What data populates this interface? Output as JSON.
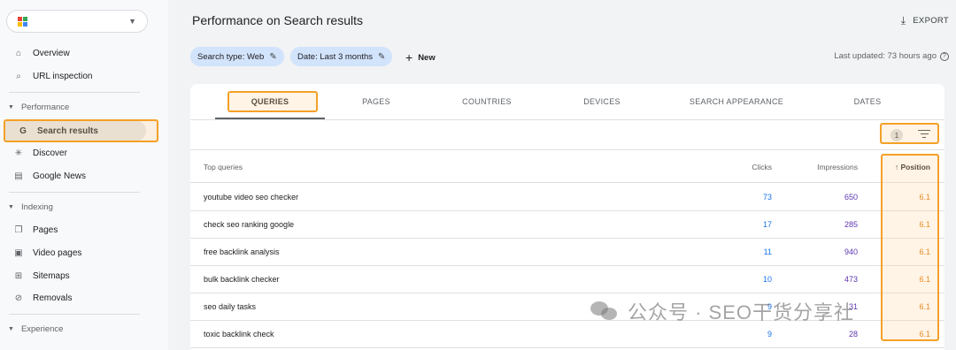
{
  "sidebar": {
    "property_logo_colors": [
      "#ea4335",
      "#34a853",
      "#fbbc04",
      "#4285f4"
    ],
    "items": [
      {
        "label": "Overview",
        "icon": "home-icon"
      },
      {
        "label": "URL inspection",
        "icon": "search-icon"
      },
      {
        "label": "Performance",
        "icon": "chevron-down-icon",
        "section": true
      },
      {
        "label": "Search results",
        "icon": "google-g-icon",
        "active": true
      },
      {
        "label": "Discover",
        "icon": "asterisk-icon"
      },
      {
        "label": "Google News",
        "icon": "news-icon"
      },
      {
        "label": "Indexing",
        "icon": "chevron-down-icon",
        "section": true
      },
      {
        "label": "Pages",
        "icon": "pages-icon"
      },
      {
        "label": "Video pages",
        "icon": "video-pages-icon"
      },
      {
        "label": "Sitemaps",
        "icon": "sitemap-icon"
      },
      {
        "label": "Removals",
        "icon": "removals-icon"
      },
      {
        "label": "Experience",
        "icon": "chevron-down-icon",
        "section": true
      }
    ]
  },
  "header": {
    "title": "Performance on Search results",
    "export_label": "EXPORT",
    "last_updated": "Last updated: 73 hours ago"
  },
  "filters": {
    "search_type": "Search type: Web",
    "date": "Date: Last 3 months",
    "new_label": "New"
  },
  "tabs": [
    "QUERIES",
    "PAGES",
    "COUNTRIES",
    "DEVICES",
    "SEARCH APPEARANCE",
    "DATES"
  ],
  "table": {
    "filter_count": "1",
    "columns": {
      "query": "Top queries",
      "clicks": "Clicks",
      "impressions": "Impressions",
      "position": "Position"
    },
    "rows": [
      {
        "query": "youtube video seo checker",
        "clicks": "73",
        "impressions": "650",
        "position": "6.1"
      },
      {
        "query": "check seo ranking google",
        "clicks": "17",
        "impressions": "285",
        "position": "6.1"
      },
      {
        "query": "free backlink analysis",
        "clicks": "11",
        "impressions": "940",
        "position": "6.1"
      },
      {
        "query": "bulk backlink checker",
        "clicks": "10",
        "impressions": "473",
        "position": "6.1"
      },
      {
        "query": "seo daily tasks",
        "clicks": "9",
        "impressions": "31",
        "position": "6.1"
      },
      {
        "query": "toxic backlink check",
        "clicks": "9",
        "impressions": "28",
        "position": "6.1"
      }
    ]
  },
  "watermark": "公众号 · SEO干货分享社",
  "colors": {
    "clicks": "#1a73e8",
    "impressions": "#5e35b1",
    "position": "#e37400",
    "highlight": "#f5a028",
    "chip": "#d2e3fc"
  }
}
